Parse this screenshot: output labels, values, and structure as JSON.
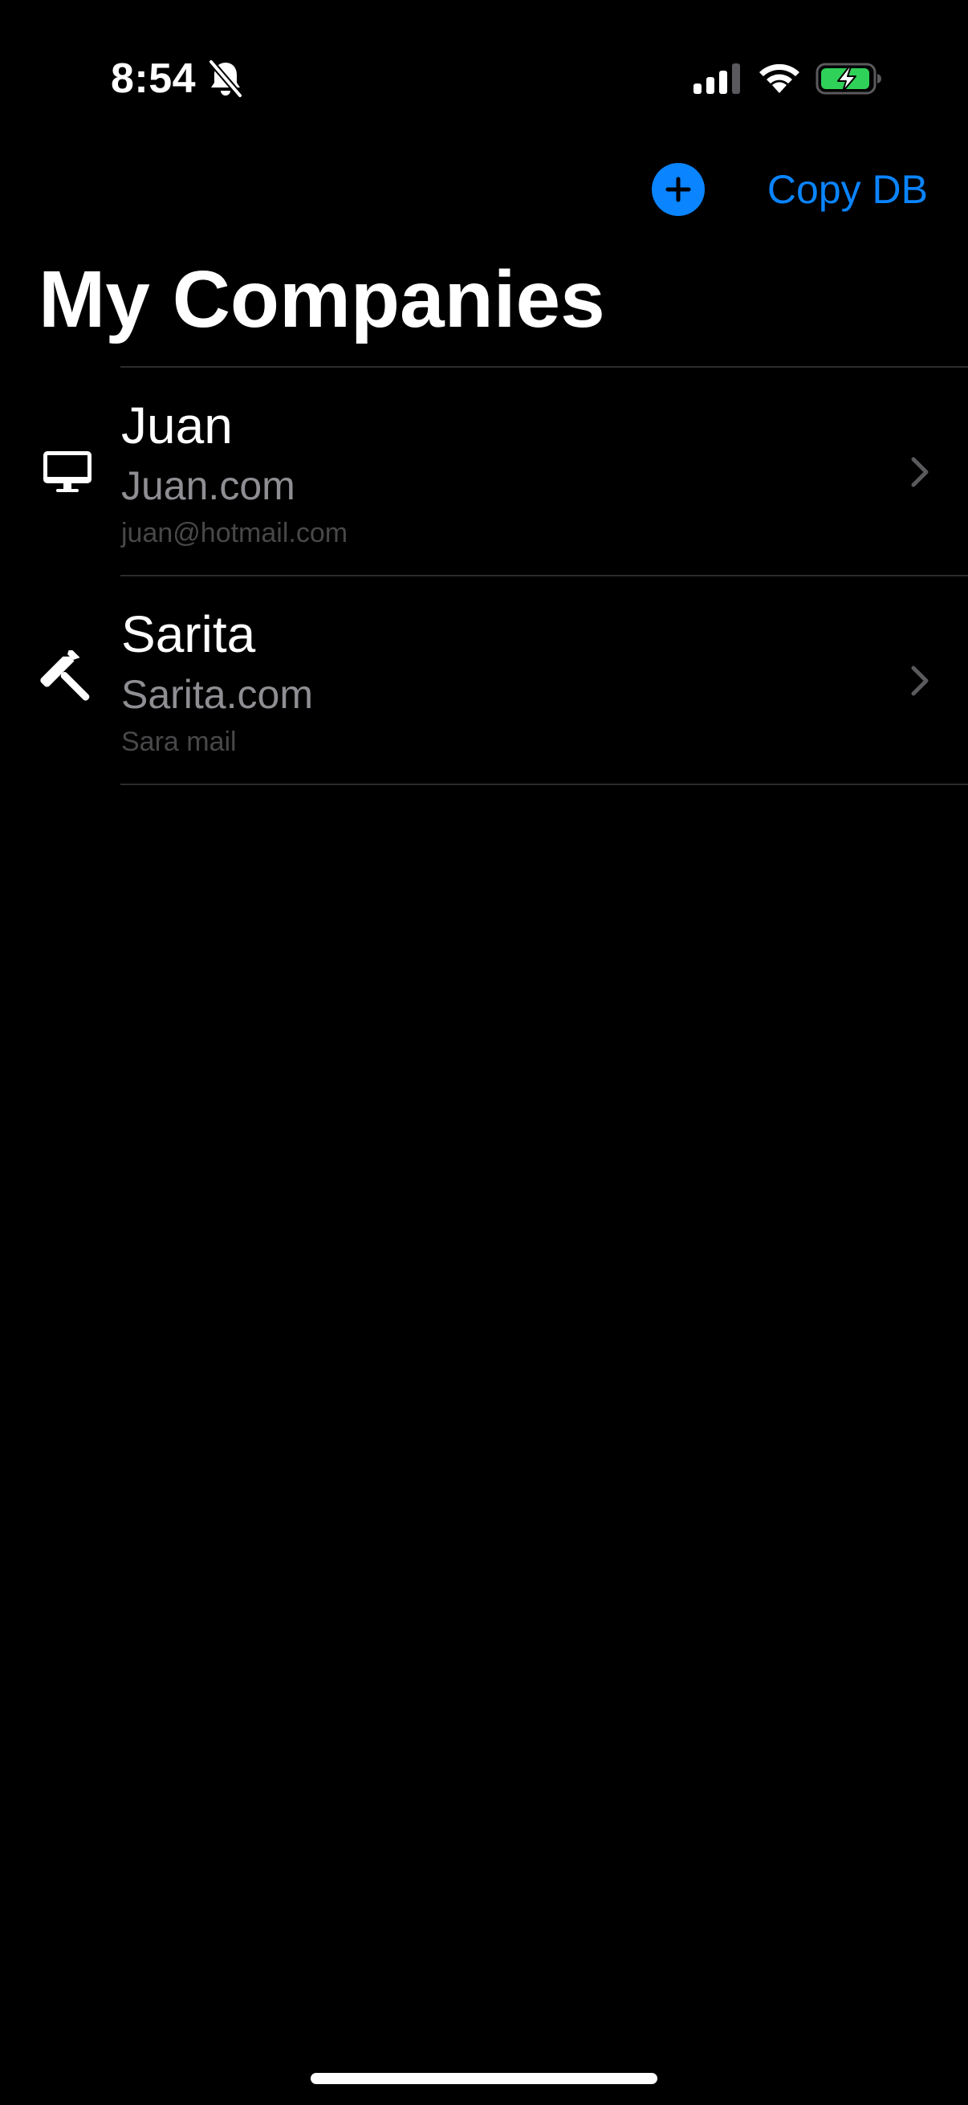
{
  "status_bar": {
    "time": "8:54",
    "silent_icon": "bell-slash-icon",
    "signal_icon": "cellular-signal-icon",
    "wifi_icon": "wifi-icon",
    "battery_icon": "battery-charging-icon",
    "battery_color": "#30d158"
  },
  "nav": {
    "add_icon": "plus-circle-icon",
    "copy_db_label": "Copy DB",
    "accent_color": "#0a84ff"
  },
  "page": {
    "title": "My Companies"
  },
  "companies": [
    {
      "icon": "desktop-computer-icon",
      "name": "Juan",
      "domain": "Juan.com",
      "email": "juan@hotmail.com"
    },
    {
      "icon": "hammer-icon",
      "name": "Sarita",
      "domain": "Sarita.com",
      "email": "Sara mail"
    }
  ]
}
